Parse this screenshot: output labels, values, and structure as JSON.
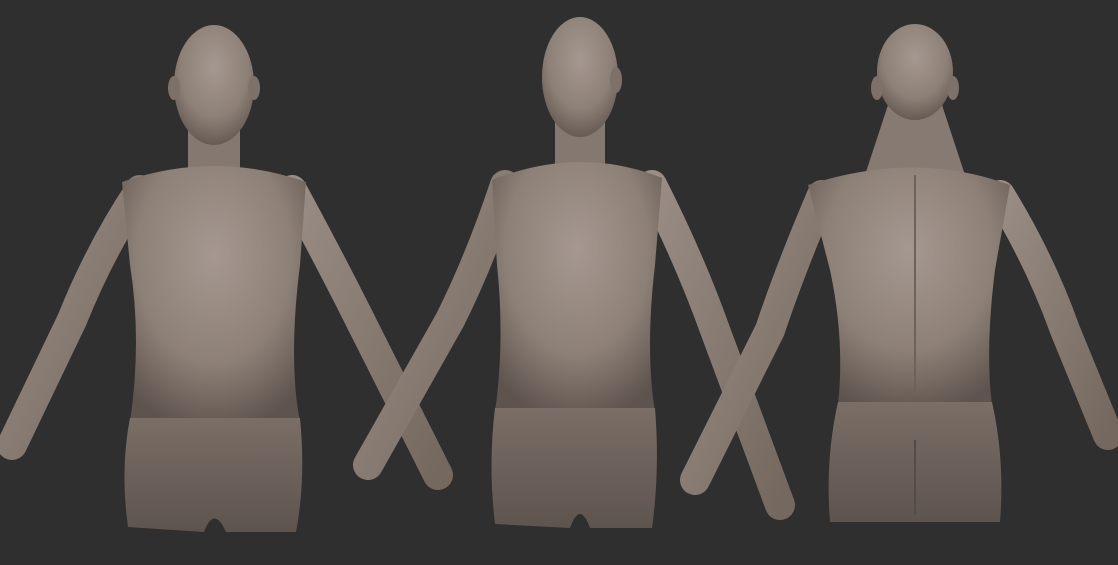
{
  "colors": {
    "background": "#2f2f2f",
    "skin": "#8d8077",
    "skin_light": "#a59890",
    "skin_shadow": "#5e534d",
    "shorts": "#6e635c"
  }
}
